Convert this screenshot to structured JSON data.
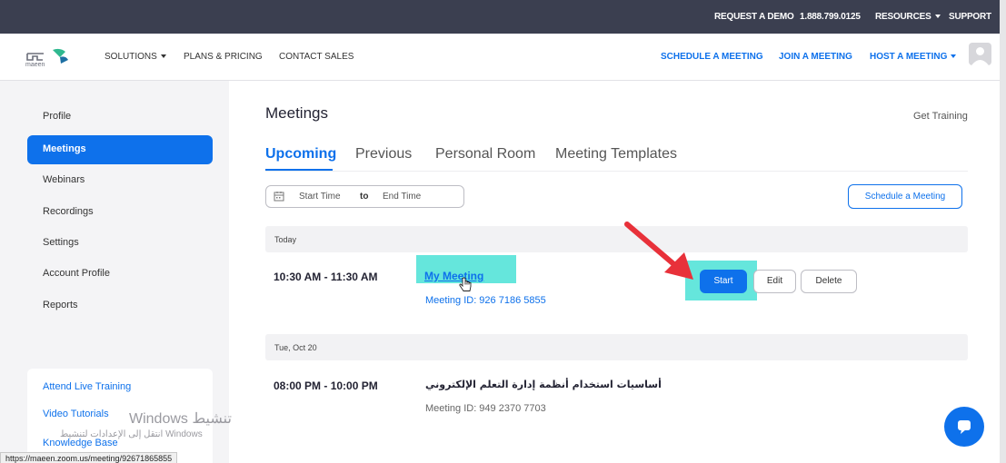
{
  "topbar": {
    "request_demo": "REQUEST A DEMO",
    "phone": "1.888.799.0125",
    "resources": "RESOURCES",
    "support": "SUPPORT"
  },
  "nav": {
    "logo_text": "maeen",
    "solutions": "SOLUTIONS",
    "plans_pricing": "PLANS & PRICING",
    "contact_sales": "CONTACT SALES",
    "schedule_meeting": "SCHEDULE A MEETING",
    "join_meeting": "JOIN A MEETING",
    "host_meeting": "HOST A MEETING"
  },
  "sidebar": {
    "items": [
      {
        "label": "Profile"
      },
      {
        "label": "Meetings"
      },
      {
        "label": "Webinars"
      },
      {
        "label": "Recordings"
      },
      {
        "label": "Settings"
      },
      {
        "label": "Account Profile"
      },
      {
        "label": "Reports"
      }
    ],
    "active_index": 1
  },
  "help": {
    "attend_training": "Attend Live Training",
    "video_tutorials": "Video Tutorials",
    "knowledge_base": "Knowledge Base"
  },
  "page": {
    "title": "Meetings",
    "get_training": "Get Training"
  },
  "tabs": [
    {
      "label": "Upcoming"
    },
    {
      "label": "Previous"
    },
    {
      "label": "Personal Room"
    },
    {
      "label": "Meeting Templates"
    }
  ],
  "filter": {
    "start_placeholder": "Start Time",
    "to": "to",
    "end_placeholder": "End Time",
    "schedule_button": "Schedule a Meeting"
  },
  "groups": [
    {
      "day": "Today",
      "meeting": {
        "time": "10:30 AM - 11:30 AM",
        "title": "My Meeting",
        "meeting_id": "Meeting ID: 926 7186 5855",
        "start": "Start",
        "edit": "Edit",
        "delete": "Delete"
      }
    },
    {
      "day": "Tue, Oct 20",
      "meeting": {
        "time": "08:00 PM - 10:00 PM",
        "title": "أساسيات استخدام أنظمة إدارة التعلم الإلكتروني",
        "meeting_id": "Meeting ID: 949 2370 7703"
      }
    }
  ],
  "watermark": {
    "line1": "Windows تنشيط",
    "line2": "انتقل إلى الإعدادات لتنشيط Windows"
  },
  "status_url": "https://maeen.zoom.us/meeting/92671865855",
  "colors": {
    "brand_blue": "#0e71eb",
    "topbar_bg": "#3b3f50",
    "highlight": "#54e3d8",
    "arrow": "#e8313a"
  }
}
